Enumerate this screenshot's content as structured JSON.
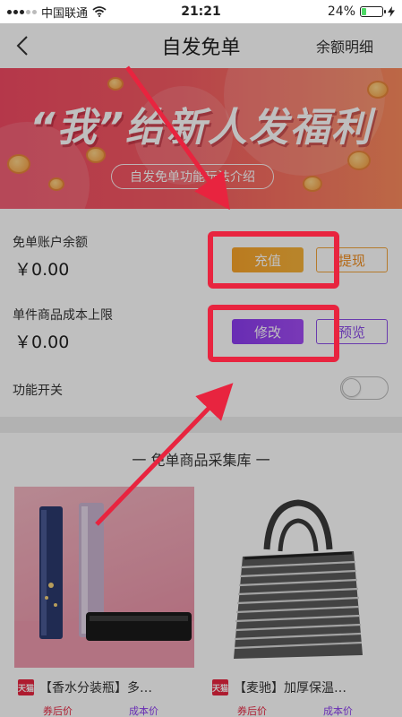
{
  "status_bar": {
    "carrier": "中国联通",
    "time": "21:21",
    "battery_percent": "24%",
    "battery_level": 0.24
  },
  "nav": {
    "title": "自发免单",
    "right_link": "余额明细",
    "back_icon": "chevron-left-icon"
  },
  "banner": {
    "title": "“我”给新人发福利",
    "subtitle_pill": "自发免单功能玩法介绍"
  },
  "account": {
    "balance_label": "免单账户余额",
    "balance_value": "￥0.00",
    "recharge_label": "充值",
    "withdraw_label": "提现",
    "cost_limit_label": "单件商品成本上限",
    "cost_limit_value": "￥0.00",
    "edit_label": "修改",
    "preview_label": "预览",
    "feature_switch_label": "功能开关",
    "feature_switch_on": false
  },
  "library": {
    "title": "一 免单商品采集库 一",
    "products": [
      {
        "badge": "天猫",
        "name": "【香水分装瓶】多…",
        "price_after_label": "券后价",
        "cost_label": "成本价"
      },
      {
        "badge": "天猫",
        "name": "【麦驰】加厚保温…",
        "price_after_label": "券后价",
        "cost_label": "成本价"
      }
    ]
  },
  "colors": {
    "highlight_red": "#e8243f",
    "orange_accent": "#f9a42a",
    "purple_accent": "#8b3cf0",
    "banner_red": "#f24a63"
  }
}
